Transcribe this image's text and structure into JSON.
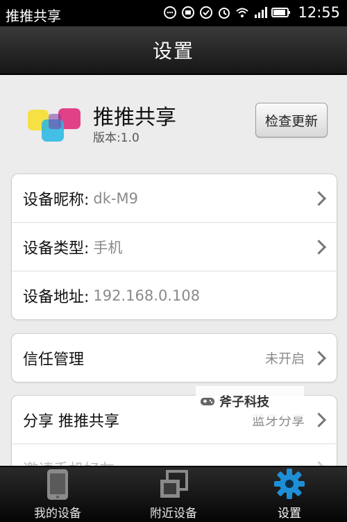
{
  "statusbar": {
    "app_title": "推推共享",
    "time": "12:55"
  },
  "titlebar": {
    "title": "设置"
  },
  "app": {
    "name": "推推共享",
    "version": "版本:1.0",
    "check_update_label": "检查更新"
  },
  "device": {
    "nickname_label": "设备昵称:",
    "nickname_value": "dk-M9",
    "type_label": "设备类型:",
    "type_value": "手机",
    "address_label": "设备地址:",
    "address_value": "192.168.0.108"
  },
  "trust": {
    "label": "信任管理",
    "status": "未开启"
  },
  "share": {
    "label": "分享 推推共享",
    "status": "蓝牙分享",
    "invite_label": "邀请手机好友"
  },
  "watermark": {
    "text": "斧子科技"
  },
  "bottomnav": {
    "items": [
      {
        "label": "我的设备",
        "icon": "phone-icon"
      },
      {
        "label": "附近设备",
        "icon": "nearby-devices-icon"
      },
      {
        "label": "设置",
        "icon": "gear-icon"
      }
    ],
    "active_index": 2,
    "active_color": "#1e8fd6"
  }
}
